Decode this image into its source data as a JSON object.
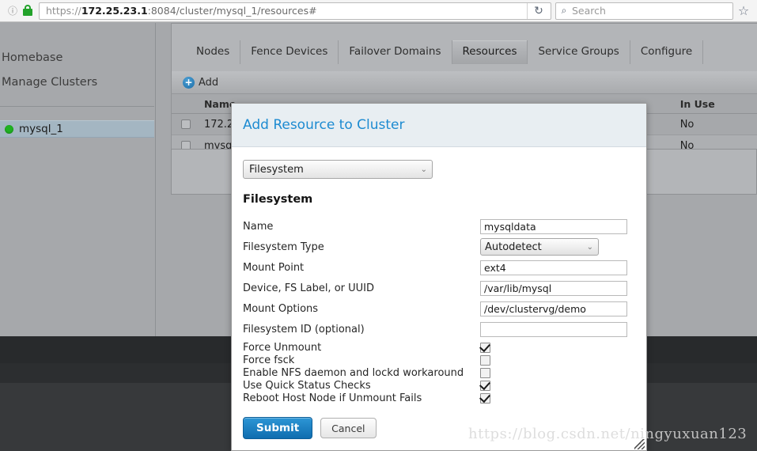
{
  "browser": {
    "url_scheme": "https://",
    "url_host": "172.25.23.1",
    "url_path": ":8084/cluster/mysql_1/resources#",
    "reload_glyph": "↻",
    "search_placeholder": "Search",
    "search_glyph": "⌕",
    "star_glyph": "☆",
    "info_glyph": "ⓘ"
  },
  "sidebar": {
    "links": [
      {
        "label": "Homebase"
      },
      {
        "label": "Manage Clusters"
      }
    ],
    "clusters": [
      {
        "label": "mysql_1",
        "status": "online",
        "status_color": "#1fb222"
      }
    ]
  },
  "tabs": [
    {
      "label": "Nodes",
      "active": false
    },
    {
      "label": "Fence Devices",
      "active": false
    },
    {
      "label": "Failover Domains",
      "active": false
    },
    {
      "label": "Resources",
      "active": true
    },
    {
      "label": "Service Groups",
      "active": false
    },
    {
      "label": "Configure",
      "active": false
    }
  ],
  "toolbar": {
    "add_label": "Add",
    "add_glyph": "+"
  },
  "table": {
    "columns": [
      "Name",
      "In Use"
    ],
    "rows": [
      {
        "name": "172.2",
        "in_use": "No"
      },
      {
        "name": "mysql",
        "in_use": "No"
      }
    ]
  },
  "dialog": {
    "title": "Add Resource to Cluster",
    "resource_type": "Filesystem",
    "section_title": "Filesystem",
    "chevron_glyph": "⌄",
    "fields": [
      {
        "label": "Name",
        "value": "mysqldata",
        "kind": "text"
      },
      {
        "label": "Filesystem Type",
        "value": "Autodetect",
        "kind": "select"
      },
      {
        "label": "Mount Point",
        "value": "ext4",
        "kind": "text"
      },
      {
        "label": "Device, FS Label, or UUID",
        "value": "/var/lib/mysql",
        "kind": "text"
      },
      {
        "label": "Mount Options",
        "value": "/dev/clustervg/demo",
        "kind": "text"
      },
      {
        "label": "Filesystem ID (optional)",
        "value": "",
        "kind": "text"
      }
    ],
    "checkboxes": [
      {
        "label": "Force Unmount",
        "checked": true
      },
      {
        "label": "Force fsck",
        "checked": false
      },
      {
        "label": "Enable NFS daemon and lockd workaround",
        "checked": false
      },
      {
        "label": "Use Quick Status Checks",
        "checked": true
      },
      {
        "label": "Reboot Host Node if Unmount Fails",
        "checked": true
      }
    ],
    "submit_label": "Submit",
    "cancel_label": "Cancel",
    "accent_color": "#1d8bd1"
  },
  "watermark": {
    "text": "https://blog.csdn.net/ningyuxuan123"
  }
}
